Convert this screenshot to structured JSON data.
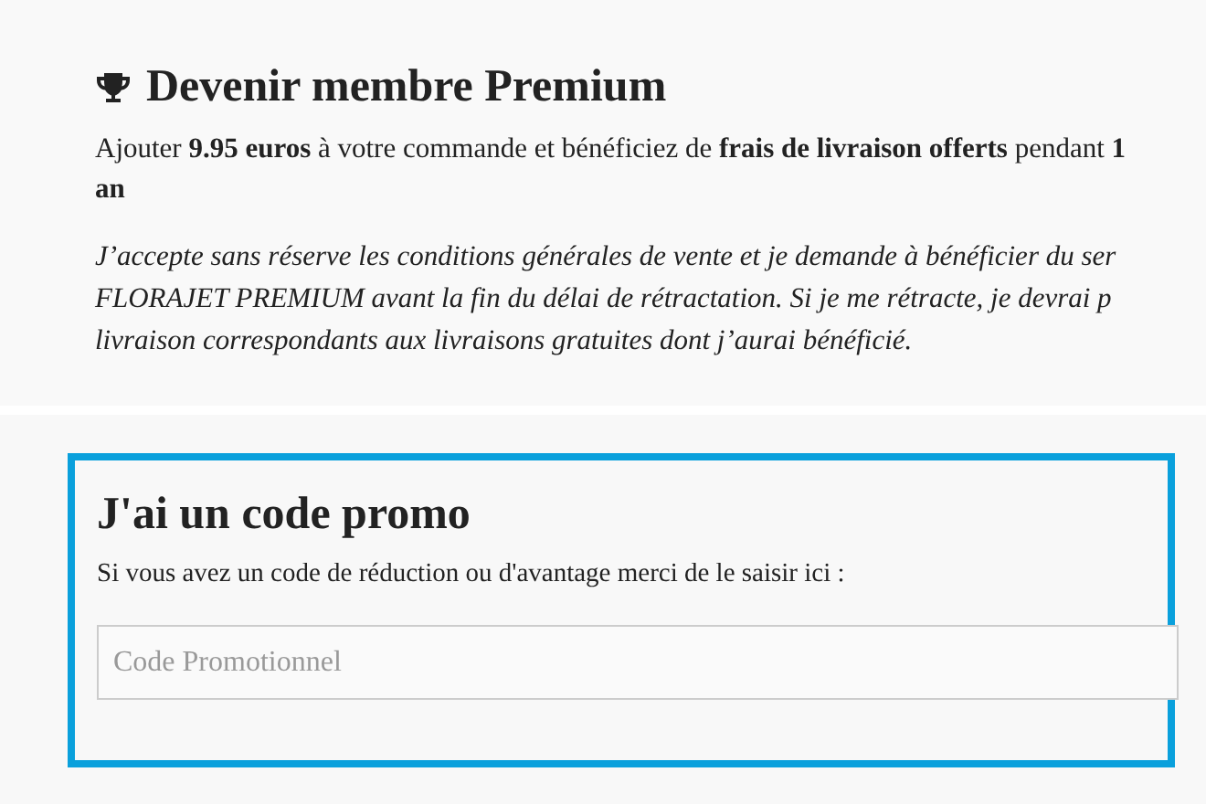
{
  "premium": {
    "title": "Devenir membre Premium",
    "offer_lines": [
      "Ajouter **9.95 euros** à votre commande et bénéficiez de **frais de livraison offerts** pendant **1**",
      "**an**"
    ],
    "terms_lines": [
      "J’accepte sans réserve les conditions générales de vente et je demande à bénéficier du ser",
      "FLORAJET PREMIUM avant la fin du délai de rétractation. Si je me rétracte, je devrai p",
      "livraison correspondants aux livraisons gratuites dont j’aurai bénéficié."
    ]
  },
  "promo": {
    "title": "J'ai un code promo",
    "text": "Si vous avez un code de réduction ou d'avantage merci de le saisir ici :",
    "field": {
      "placeholder": "Code Promotionnel"
    }
  }
}
